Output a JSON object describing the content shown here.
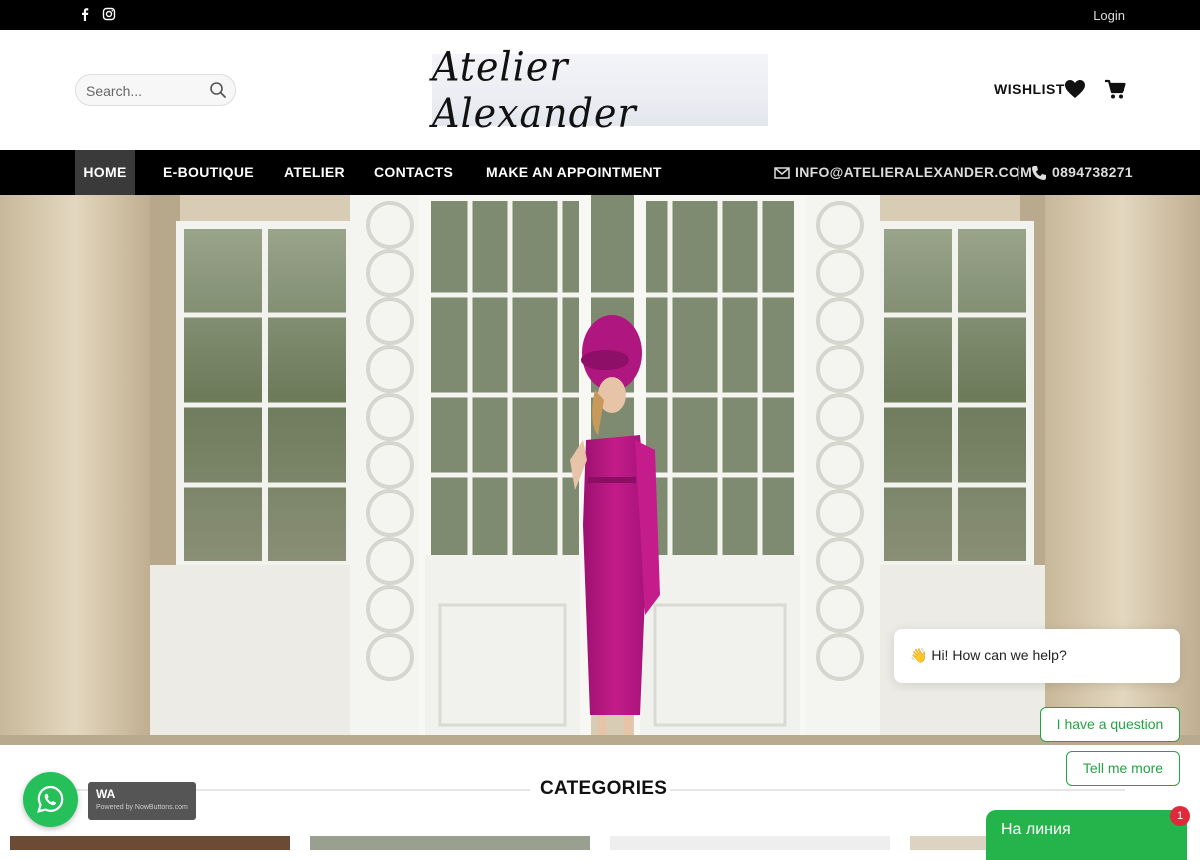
{
  "topbar": {
    "login_label": "Login"
  },
  "header": {
    "search_placeholder": "Search...",
    "logo_text": "Atelier Alexander",
    "wishlist_label": "WISHLIST"
  },
  "nav": {
    "items": [
      {
        "label": "HOME",
        "active": true
      },
      {
        "label": "E-BOUTIQUE"
      },
      {
        "label": "ATELIER"
      },
      {
        "label": "CONTACTS"
      },
      {
        "label": "MAKE AN APPOINTMENT"
      }
    ],
    "email": "INFO@ATELIERALEXANDER.COM",
    "phone": "0894738271"
  },
  "section": {
    "title": "CATEGORIES"
  },
  "chat": {
    "greeting": "Hi! How can we help?",
    "greeting_emoji": "👋",
    "options": [
      "I have a question",
      "Tell me more"
    ],
    "online_label": "На линия",
    "badge_count": "1"
  },
  "whatsapp": {
    "label": "WA",
    "powered_by": "Powered by NowButtons.com"
  },
  "colors": {
    "accent_green": "#25b34b",
    "dress_magenta": "#b4177f",
    "badge_red": "#e2283a"
  }
}
